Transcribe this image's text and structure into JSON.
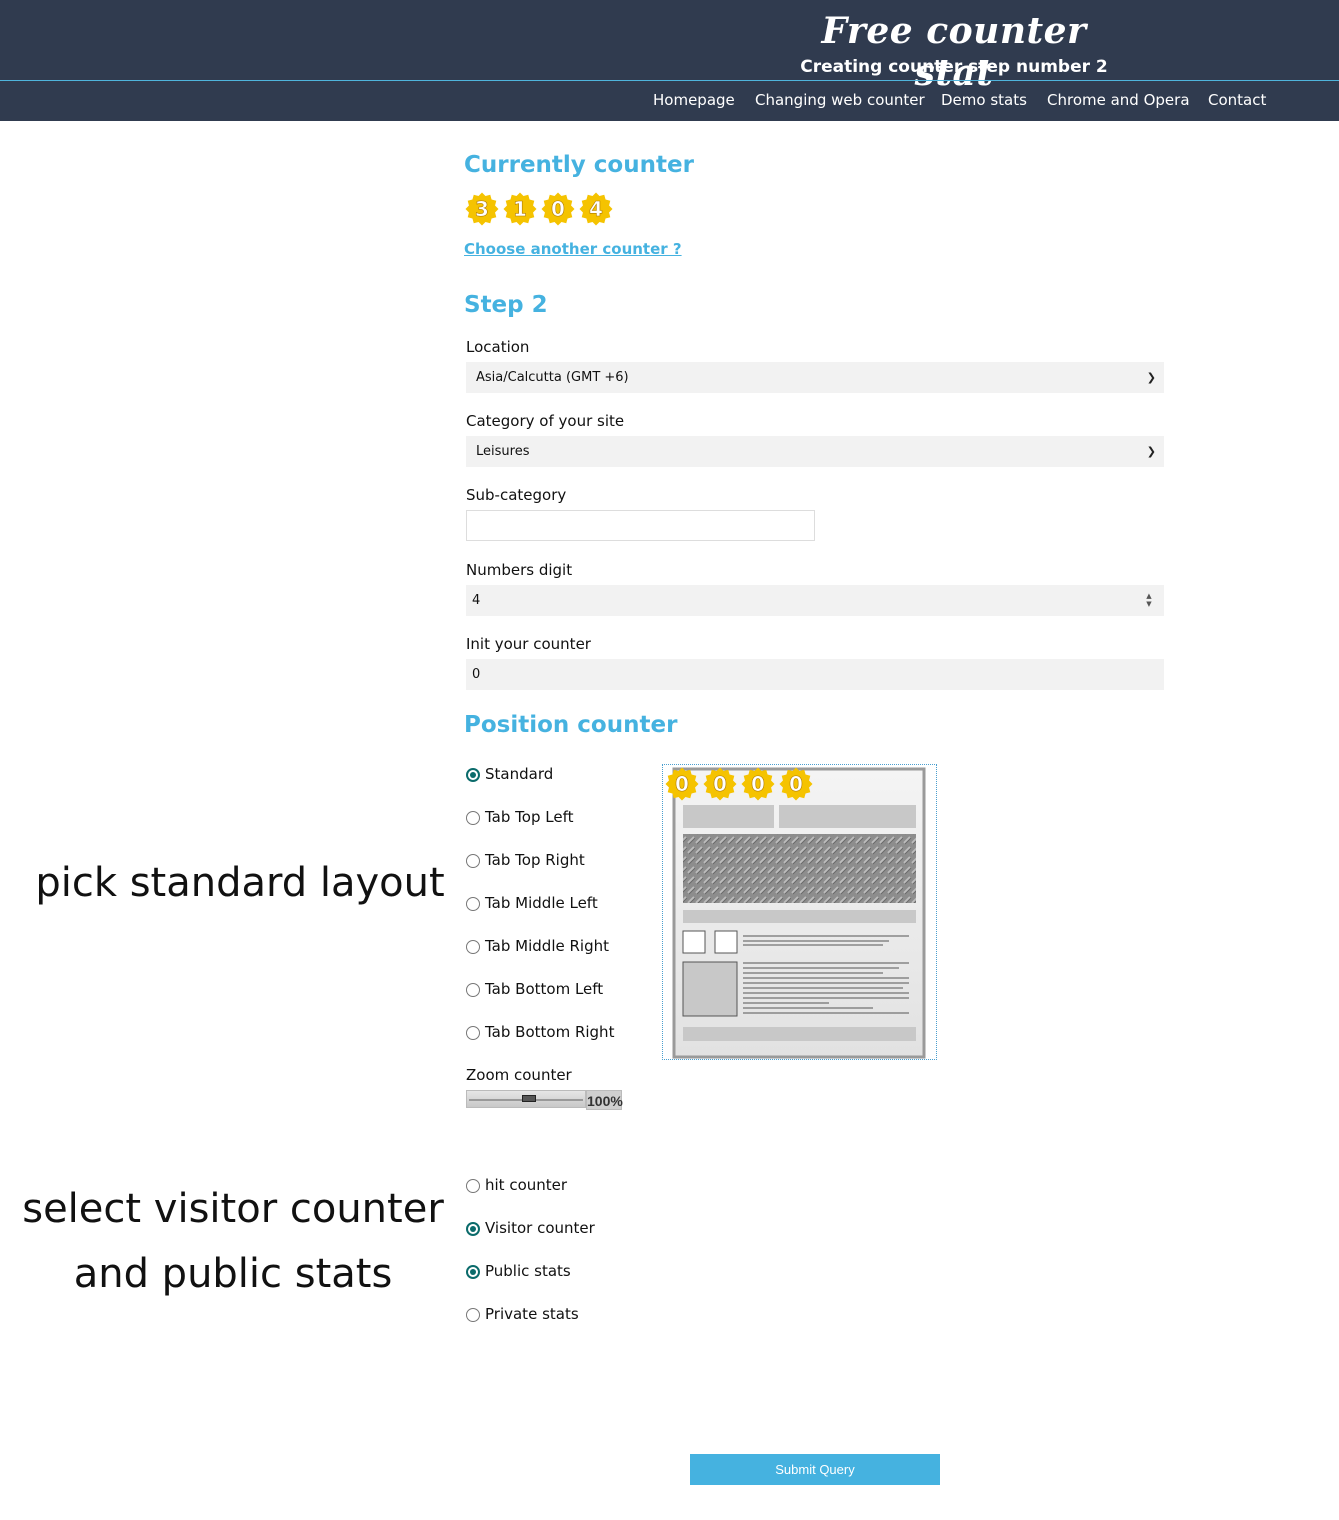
{
  "header": {
    "title": "Free counter stat",
    "subtitle": "Creating counter step number 2",
    "nav": [
      "Homepage",
      "Changing web counter",
      "Demo stats",
      "Chrome and Opera",
      "Contact"
    ]
  },
  "current": {
    "heading": "Currently counter",
    "digits": [
      "3",
      "1",
      "0",
      "4"
    ],
    "choose_link": "Choose another counter ?"
  },
  "step2": {
    "heading": "Step 2",
    "location_label": "Location",
    "location_value": "Asia/Calcutta (GMT +6)",
    "category_label": "Category of your site",
    "category_value": "Leisures",
    "subcategory_label": "Sub-category",
    "subcategory_value": "",
    "digits_label": "Numbers digit",
    "digits_value": "4",
    "init_label": "Init your counter",
    "init_value": "0"
  },
  "position": {
    "heading": "Position counter",
    "options": [
      {
        "label": "Standard",
        "checked": true
      },
      {
        "label": "Tab Top Left",
        "checked": false
      },
      {
        "label": "Tab Top Right",
        "checked": false
      },
      {
        "label": "Tab Middle Left",
        "checked": false
      },
      {
        "label": "Tab Middle Right",
        "checked": false
      },
      {
        "label": "Tab Bottom Left",
        "checked": false
      },
      {
        "label": "Tab Bottom Right",
        "checked": false
      }
    ],
    "preview_digits": [
      "0",
      "0",
      "0",
      "0"
    ],
    "zoom_label": "Zoom counter",
    "zoom_value": "100%"
  },
  "counter_type": {
    "options": [
      {
        "label": "hit counter",
        "checked": false
      },
      {
        "label": "Visitor counter",
        "checked": true
      },
      {
        "label": "Public stats",
        "checked": true
      },
      {
        "label": "Private stats",
        "checked": false
      }
    ]
  },
  "annotations": {
    "layout_note": "pick standard layout",
    "visitor_note_line1": "select visitor counter",
    "visitor_note_line2": "and public stats"
  },
  "submit_label": "Submit Query",
  "colors": {
    "header_bg": "#303b4f",
    "accent": "#45b2e0",
    "coin": "#f5c300",
    "radio_checked": "#0b6b6b"
  }
}
